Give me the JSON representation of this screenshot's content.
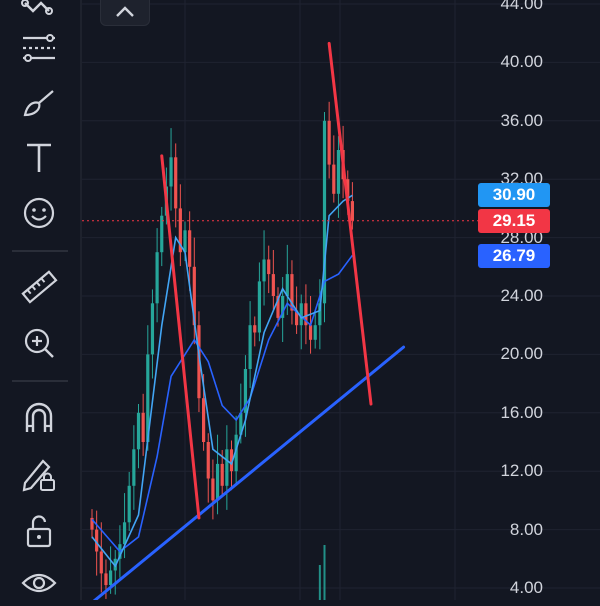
{
  "toolbar": {
    "tools": [
      {
        "icon": "pattern-tool-icon"
      },
      {
        "icon": "fib-retracement-icon"
      },
      {
        "icon": "brush-icon"
      },
      {
        "icon": "text-tool-icon",
        "glyph": "T"
      },
      {
        "icon": "emoji-icon"
      },
      {
        "icon": "ruler-icon"
      },
      {
        "icon": "zoom-in-icon"
      },
      {
        "icon": "magnet-icon"
      },
      {
        "icon": "pencil-lock-icon"
      },
      {
        "icon": "unlock-icon"
      },
      {
        "icon": "eye-icon"
      }
    ]
  },
  "colors": {
    "background": "#131722",
    "up": "#26a69a",
    "down": "#ef5350",
    "ma_fast": "#42a5f5",
    "ma_slow": "#2962ff",
    "trendline_blue": "#2962ff",
    "trendline_red": "#f23645",
    "tag_blue_light": "#2196f3",
    "tag_red": "#f23645",
    "tag_blue": "#2962ff"
  },
  "chart_data": {
    "type": "candlestick",
    "y_axis_labels": [
      "44.00",
      "40.00",
      "36.00",
      "32.00",
      "28.00",
      "24.00",
      "20.00",
      "16.00",
      "12.00",
      "8.00",
      "4.00"
    ],
    "ylim": [
      3.0,
      44.5
    ],
    "price_tags": [
      {
        "label": "30.90",
        "value": 30.9,
        "color": "#2196f3"
      },
      {
        "label": "29.15",
        "value": 29.15,
        "color": "#f23645"
      },
      {
        "label": "26.79",
        "value": 26.79,
        "color": "#2962ff"
      }
    ],
    "last_price_line": 29.15,
    "closes": [
      8.0,
      6.5,
      5.0,
      4.2,
      5.2,
      6.0,
      7.0,
      8.5,
      11.0,
      13.5,
      16.0,
      14.0,
      20.0,
      23.5,
      27.0,
      29.5,
      31.5,
      33.5,
      30.0,
      27.0,
      28.5,
      26.0,
      22.0,
      17.0,
      14.0,
      11.5,
      10.0,
      12.5,
      11.0,
      13.5,
      12.0,
      14.5,
      16.0,
      19.0,
      22.0,
      21.5,
      25.0,
      26.5,
      25.5,
      24.0,
      22.5,
      24.0,
      25.5,
      23.0,
      22.0,
      23.5,
      22.0,
      21.0,
      22.0,
      23.5,
      36.0,
      33.0,
      31.0,
      34.0,
      32.0,
      30.5,
      29.15
    ],
    "ma_fast_points": [
      [
        0,
        7.5
      ],
      [
        5,
        5.5
      ],
      [
        10,
        9.0
      ],
      [
        15,
        22.0
      ],
      [
        18,
        28.0
      ],
      [
        20,
        27.0
      ],
      [
        23,
        20.0
      ],
      [
        26,
        13.5
      ],
      [
        30,
        12.5
      ],
      [
        33,
        15.5
      ],
      [
        37,
        21.5
      ],
      [
        41,
        24.5
      ],
      [
        45,
        22.5
      ],
      [
        49,
        23.0
      ],
      [
        51,
        29.5
      ],
      [
        54,
        30.5
      ],
      [
        56,
        30.9
      ]
    ],
    "ma_slow_points": [
      [
        0,
        8.7
      ],
      [
        6,
        6.5
      ],
      [
        10,
        7.5
      ],
      [
        14,
        13.0
      ],
      [
        17,
        18.5
      ],
      [
        20,
        20.0
      ],
      [
        22,
        21.0
      ],
      [
        25,
        19.5
      ],
      [
        28,
        16.5
      ],
      [
        31,
        15.5
      ],
      [
        34,
        17.0
      ],
      [
        38,
        21.0
      ],
      [
        42,
        23.5
      ],
      [
        47,
        22.0
      ],
      [
        50,
        25.0
      ],
      [
        53,
        25.5
      ],
      [
        56,
        26.79
      ]
    ],
    "volume_spikes": [
      50
    ],
    "trendlines": [
      {
        "color": "#2962ff",
        "from": [
          0,
          3.0
        ],
        "to": [
          67,
          20.5
        ]
      },
      {
        "color": "#f23645",
        "from": [
          15,
          33.6
        ],
        "to": [
          23,
          8.8
        ]
      },
      {
        "color": "#f23645",
        "from": [
          51,
          41.3
        ],
        "to": [
          60,
          16.6
        ]
      }
    ]
  }
}
